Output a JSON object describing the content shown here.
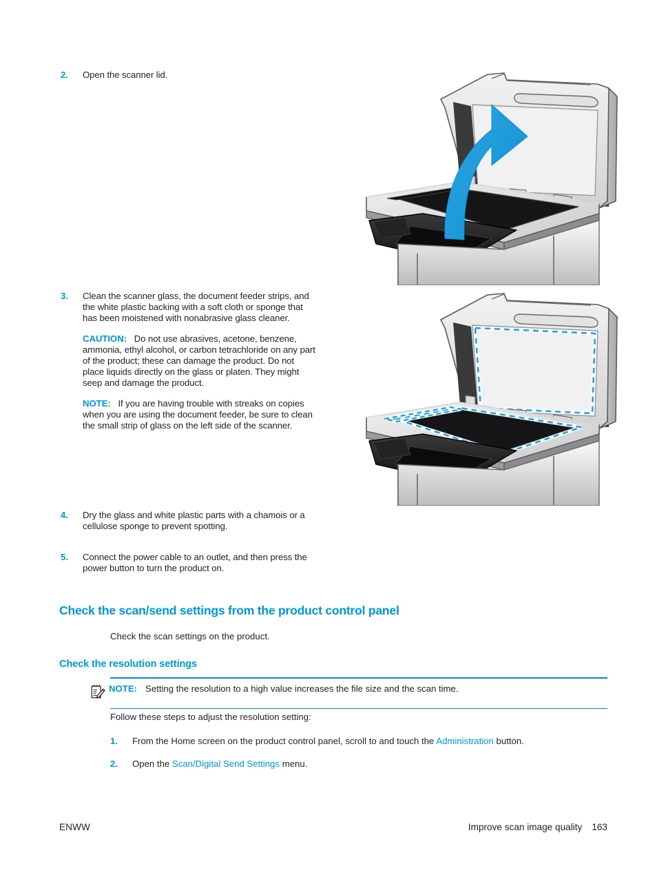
{
  "page": {
    "number": "163",
    "footer_left": "ENWW",
    "footer_right": "Improve scan image quality"
  },
  "steps": [
    {
      "num": "2.",
      "paragraphs": [
        {
          "text": "Open the scanner lid."
        }
      ]
    },
    {
      "num": "3.",
      "paragraphs": [
        {
          "text": "Clean the scanner glass, the document feeder strips, and the white plastic backing with a soft cloth or sponge that has been moistened with nonabrasive glass cleaner."
        },
        {
          "label": "CAUTION:",
          "text": "Do not use abrasives, acetone, benzene, ammonia, ethyl alcohol, or carbon tetrachloride on any part of the product; these can damage the product. Do not place liquids directly on the glass or platen. They might seep and damage the product."
        },
        {
          "label": "NOTE:",
          "text": "If you are having trouble with streaks on copies when you are using the document feeder, be sure to clean the small strip of glass on the left side of the scanner."
        }
      ]
    },
    {
      "num": "4.",
      "paragraphs": [
        {
          "text": "Dry the glass and white plastic parts with a chamois or a cellulose sponge to prevent spotting."
        }
      ]
    },
    {
      "num": "5.",
      "paragraphs": [
        {
          "text": "Connect the power cable to an outlet, and then press the power button to turn the product on."
        }
      ]
    }
  ],
  "section": {
    "heading": "Check the scan/send settings from the product control panel",
    "intro": "Check the scan settings on the product.",
    "subheading": "Check the resolution settings",
    "note": {
      "label": "NOTE:",
      "text": "Setting the resolution to a high value increases the file size and the scan time.",
      "icon": "note-pencil-icon"
    },
    "lead_in": "Follow these steps to adjust the resolution setting:",
    "sub_steps": [
      {
        "num": "1.",
        "pre": "From the Home screen on the product control panel, scroll to and touch the ",
        "link": "Administration",
        "post": " button."
      },
      {
        "num": "2.",
        "pre": "Open the ",
        "link": "Scan/Digital Send Settings",
        "post": " menu."
      }
    ]
  },
  "figures": [
    {
      "name": "scanner-lid-open-illustration",
      "caption": "Scanner with lid being opened, blue curved arrow"
    },
    {
      "name": "scanner-clean-areas-illustration",
      "caption": "Scanner with dashed blue outlines marking glass and backing areas to clean"
    }
  ],
  "colors": {
    "accent": "#0096d6",
    "rule": "#0b84c4",
    "text": "#231f20"
  }
}
